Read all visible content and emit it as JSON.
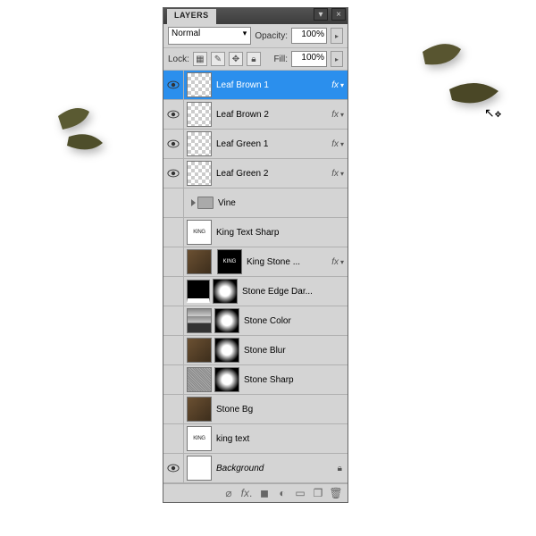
{
  "panel": {
    "title": "LAYERS"
  },
  "blend": {
    "mode": "Normal",
    "opacityLabel": "Opacity:",
    "opacity": "100%",
    "lockLabel": "Lock:",
    "fillLabel": "Fill:",
    "fill": "100%"
  },
  "layers": [
    {
      "name": "Leaf Brown 1",
      "eye": true,
      "sel": true,
      "thumb": "checker",
      "fx": true
    },
    {
      "name": "Leaf Brown 2",
      "eye": true,
      "thumb": "checker",
      "fx": true
    },
    {
      "name": "Leaf Green 1",
      "eye": true,
      "thumb": "checker",
      "fx": true
    },
    {
      "name": "Leaf Green 2",
      "eye": true,
      "thumb": "checker",
      "fx": true
    },
    {
      "name": "Vine",
      "folder": true
    },
    {
      "name": "King Text Sharp",
      "thumb": "king"
    },
    {
      "name": "King Stone ...",
      "thumb": "brown",
      "mask": "kingmask",
      "fx": true
    },
    {
      "name": "Stone Edge Dar...",
      "thumb": "edgedark",
      "mask": true
    },
    {
      "name": "Stone Color",
      "thumb": "bars",
      "mask": true
    },
    {
      "name": "Stone Blur",
      "thumb": "brown",
      "mask": true
    },
    {
      "name": "Stone Sharp",
      "thumb": "noise",
      "mask": true
    },
    {
      "name": "Stone Bg",
      "thumb": "brown"
    },
    {
      "name": "king text",
      "thumb": "king"
    },
    {
      "name": "Background",
      "eye": true,
      "thumb": "white",
      "italic": true,
      "lock": true
    }
  ],
  "footerIcons": [
    "link",
    "fx",
    "mask",
    "adjust",
    "group",
    "new",
    "trash"
  ]
}
